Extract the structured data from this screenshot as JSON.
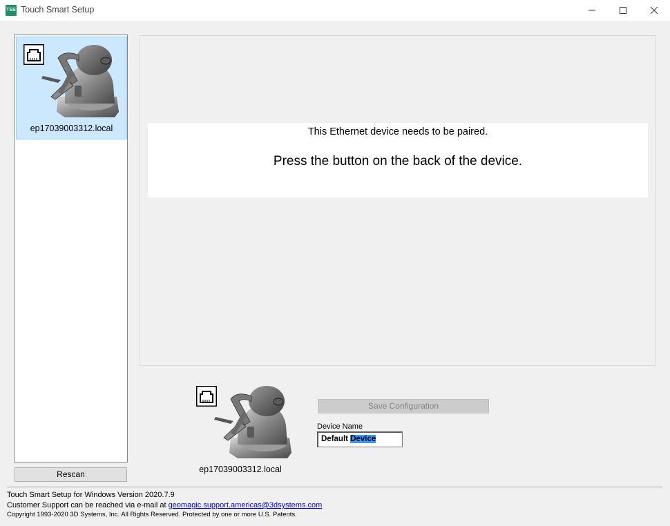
{
  "window": {
    "title": "Touch Smart Setup",
    "icon_text": "TSS",
    "controls": [
      "minimize-icon",
      "maximize-icon",
      "close-icon"
    ]
  },
  "device_list": {
    "items": [
      {
        "label": "ep17039003312.local",
        "selected": true,
        "icon": "ethernet-port-icon"
      }
    ],
    "rescan_label": "Rescan"
  },
  "main": {
    "message_line1": "This Ethernet device needs to be paired.",
    "message_line2": "Press the button on the back of the device."
  },
  "selected_device": {
    "label": "ep17039003312.local",
    "save_button": "Save Configuration",
    "save_enabled": false,
    "device_name_label": "Device Name",
    "device_name_value_part1": "Default ",
    "device_name_value_selected": "Device"
  },
  "footer": {
    "version": "Touch Smart Setup for Windows Version 2020.7.9",
    "support_prefix": "Customer Support can be reached via e-mail at ",
    "support_email": "geomagic.support.americas@3dsystems.com",
    "copyright": "Copyright 1993-2020 3D Systems, Inc. All Rights Reserved. Protected by one or more U.S. Patents."
  },
  "colors": {
    "selection": "#cce8ff",
    "text_selection": "#3399ff",
    "link": "#0000ee"
  }
}
